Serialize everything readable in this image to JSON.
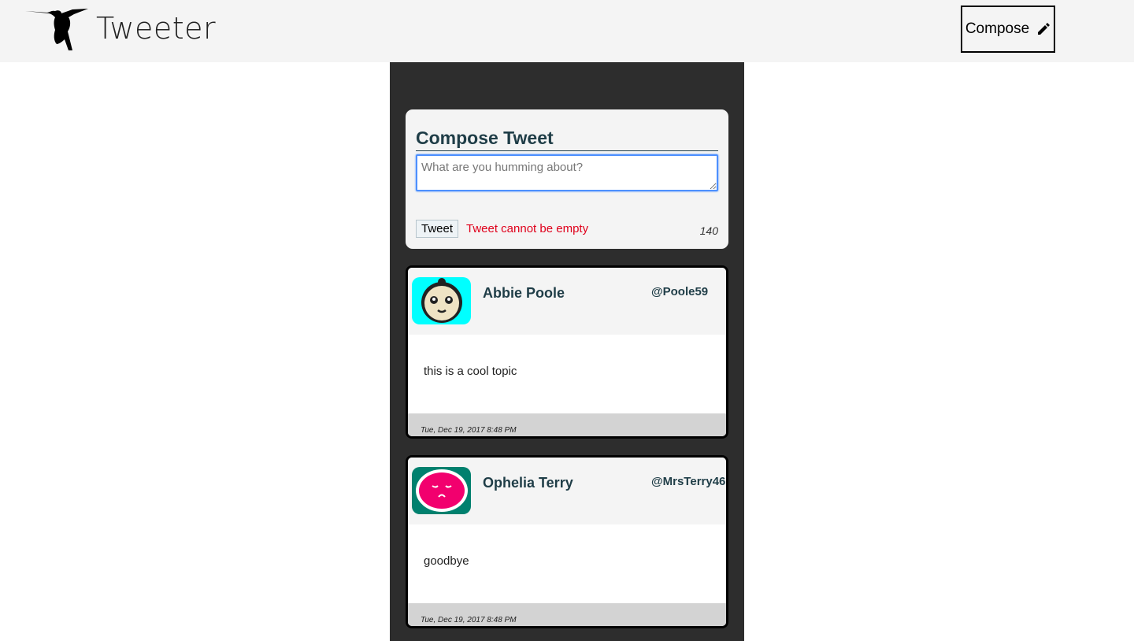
{
  "nav": {
    "brand": "Tweeter",
    "compose_label": "Compose",
    "logo_icon": "hummingbird-logo-icon",
    "compose_icon": "pencil-icon"
  },
  "compose_form": {
    "title": "Compose Tweet",
    "placeholder": "What are you humming about?",
    "value": "",
    "submit_label": "Tweet",
    "error_message": "Tweet cannot be empty",
    "counter": "140",
    "error_color": "#e0001b"
  },
  "tweets": [
    {
      "name": "Abbie Poole",
      "handle": "@Poole59",
      "content": "this is a cool topic",
      "timestamp": "Tue, Dec 19, 2017 8:48 PM",
      "avatar_color": "#00ffff"
    },
    {
      "name": "Ophelia Terry",
      "handle": "@MrsTerry46",
      "content": "goodbye",
      "timestamp": "Tue, Dec 19, 2017 8:48 PM",
      "avatar_color": "#00806e"
    }
  ],
  "colors": {
    "nav_bg": "#f4f4f4",
    "container_bg": "#2d2d2d",
    "heading_text": "#1f3d47"
  }
}
